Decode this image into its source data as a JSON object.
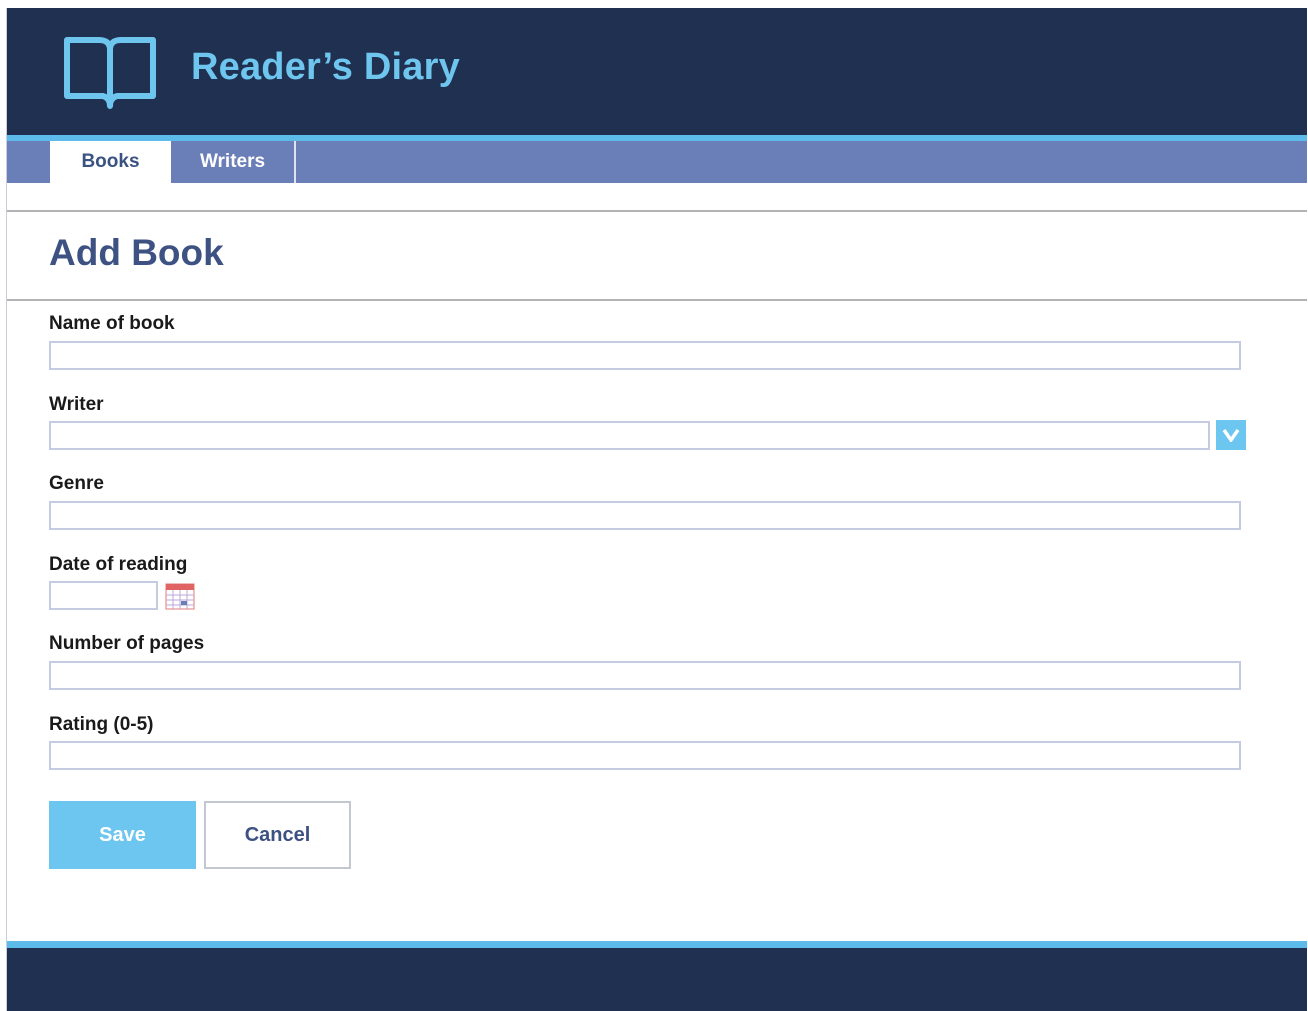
{
  "app": {
    "title": "Reader’s Diary",
    "logo_icon": "open-book-icon",
    "colors": {
      "header_bg": "#1f3050",
      "accent": "#5cbbe9",
      "nav_bg": "#6a7fb8",
      "title_text": "#6ec5ee",
      "heading": "#3d5282",
      "primary_button": "#6cc6ef"
    }
  },
  "nav": {
    "tabs": [
      {
        "label": "Books",
        "active": true
      },
      {
        "label": "Writers",
        "active": false
      }
    ]
  },
  "page": {
    "title": "Add Book"
  },
  "form": {
    "name_of_book": {
      "label": "Name of book",
      "value": "",
      "placeholder": ""
    },
    "writer": {
      "label": "Writer",
      "value": "",
      "placeholder": "",
      "dropdown_icon": "chevron-down-icon"
    },
    "genre": {
      "label": "Genre",
      "value": "",
      "placeholder": ""
    },
    "date_of_reading": {
      "label": "Date of reading",
      "value": "",
      "placeholder": "",
      "picker_icon": "calendar-icon"
    },
    "number_of_pages": {
      "label": "Number of pages",
      "value": "",
      "placeholder": ""
    },
    "rating": {
      "label": "Rating (0-5)",
      "value": "",
      "placeholder": ""
    }
  },
  "actions": {
    "save_label": "Save",
    "cancel_label": "Cancel"
  }
}
